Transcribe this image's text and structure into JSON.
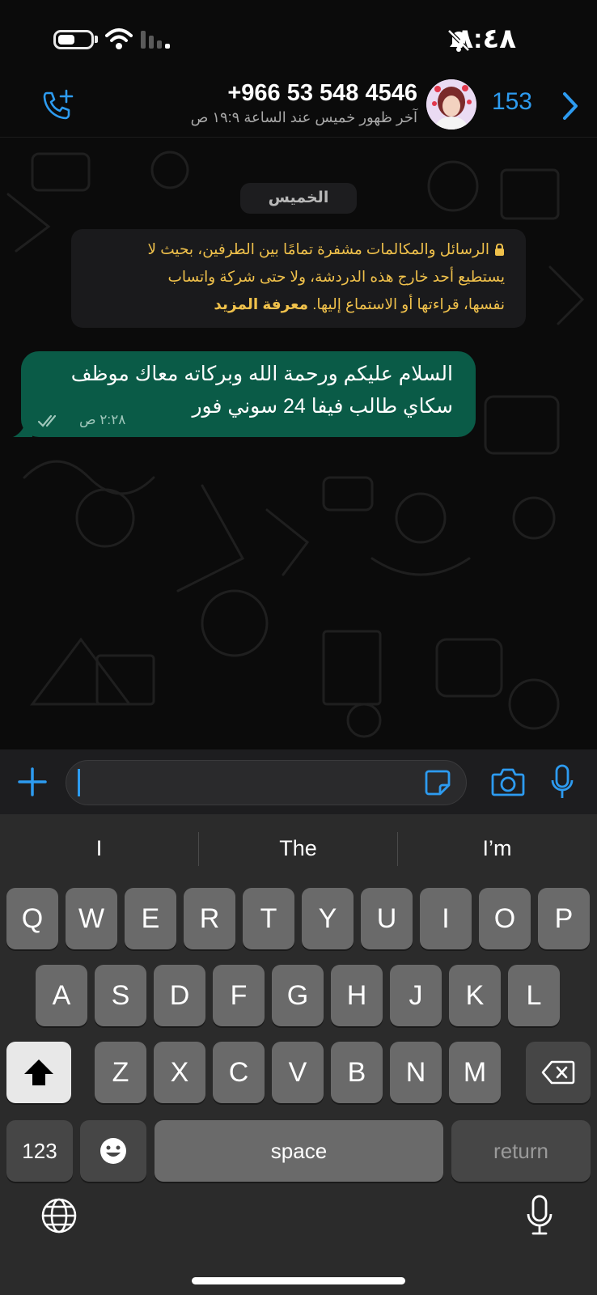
{
  "status_bar": {
    "time": "٨:٤٨"
  },
  "header": {
    "back_count": "153",
    "phone": "+966 53 548 4546",
    "last_seen": "آخر ظهور خميس عند الساعة ١٩:٩ ص"
  },
  "chat": {
    "date_chip": "الخميس",
    "encryption_notice": {
      "line1": "الرسائل والمكالمات مشفرة تمامًا بين الطرفين، بحيث لا",
      "line2": "يستطيع أحد خارج هذه الدردشة، ولا حتى شركة واتساب",
      "line3_text": "نفسها، قراءتها أو الاستماع إليها. ",
      "learn_more": "معرفة المزيد"
    },
    "messages": [
      {
        "text_line1": "السلام عليكم ورحمة الله وبركاته معاك موظف",
        "text_line2": "سكاي طالب فيفا 24 سوني فور",
        "time": "٢:٢٨ ص"
      }
    ]
  },
  "input": {
    "value": ""
  },
  "keyboard": {
    "suggestions": [
      "I",
      "The",
      "I’m"
    ],
    "row1": [
      "Q",
      "W",
      "E",
      "R",
      "T",
      "Y",
      "U",
      "I",
      "O",
      "P"
    ],
    "row2": [
      "A",
      "S",
      "D",
      "F",
      "G",
      "H",
      "J",
      "K",
      "L"
    ],
    "row3": [
      "Z",
      "X",
      "C",
      "V",
      "B",
      "N",
      "M"
    ],
    "numbers_key": "123",
    "space_key": "space",
    "return_key": "return"
  },
  "colors": {
    "accent": "#2d9bf0",
    "bubble_out": "#0a5b47",
    "notice_text": "#f0c14b"
  }
}
